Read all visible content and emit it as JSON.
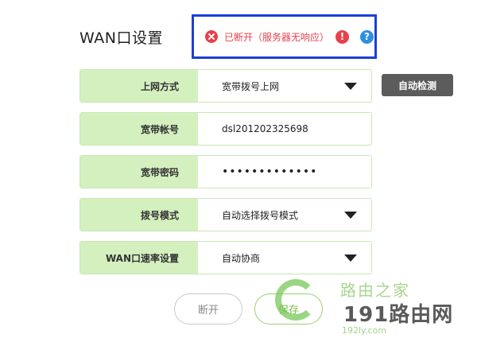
{
  "page": {
    "title": "WAN口设置"
  },
  "status": {
    "text": "已断开（服务器无响应）",
    "warn_glyph": "!",
    "help_glyph": "?",
    "color": "#e8414b",
    "highlight_color": "#1a3fd6"
  },
  "form": {
    "rows": [
      {
        "label": "上网方式",
        "value": "宽带拨号上网"
      },
      {
        "label": "宽带帐号",
        "value": "dsl201202325698"
      },
      {
        "label": "宽带密码",
        "value": "•••••••••••••"
      },
      {
        "label": "拨号模式",
        "value": "自动选择拨号模式"
      },
      {
        "label": "WAN口速率设置",
        "value": "自动协商"
      }
    ]
  },
  "buttons": {
    "auto_detect": "自动检测",
    "disconnect": "断开",
    "save": "保存"
  },
  "watermark": {
    "line1": "路由之家",
    "line2": "191路由网",
    "line3": "192ly.com"
  },
  "colors": {
    "label_bg": "#d4f0bf",
    "accent_green": "#7dbb4c",
    "button_dark": "#5c5c5c"
  }
}
